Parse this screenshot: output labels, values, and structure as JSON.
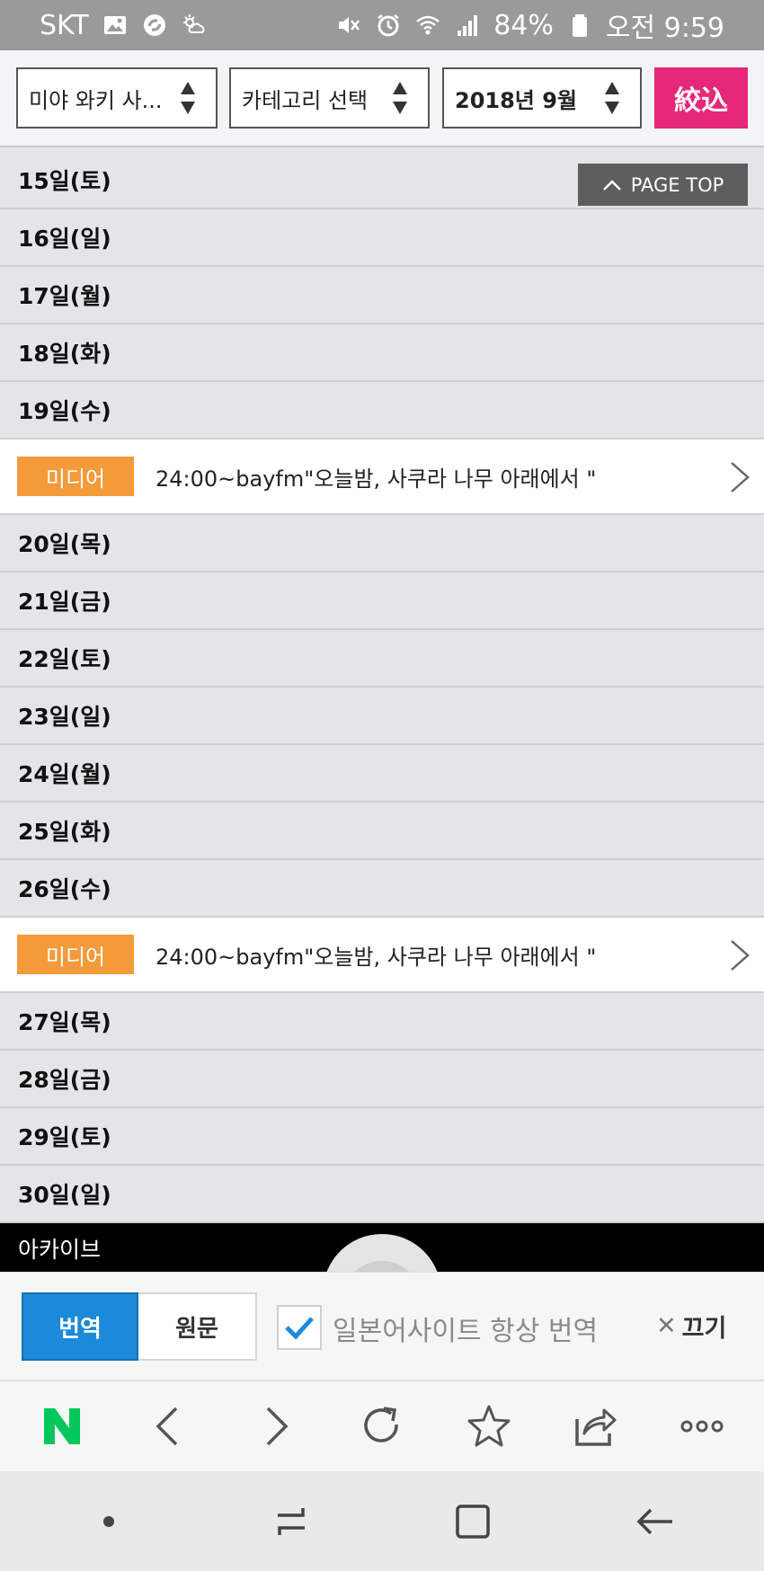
{
  "status_bar": {
    "carrier": "SKT",
    "battery": "84%",
    "time": "오전 9:59",
    "icons": [
      "image-icon",
      "sync-icon",
      "weather-icon",
      "mute-icon",
      "alarm-icon",
      "wifi-icon",
      "signal-icon",
      "battery-icon"
    ]
  },
  "filters": {
    "artist_select": "미야 와키 사...",
    "category_select": "카테고리 선택",
    "month_select": "2018년 9월",
    "filter_button": "絞込"
  },
  "page_top_label": "PAGE TOP",
  "rows": [
    {
      "type": "day",
      "label": "15일(토)"
    },
    {
      "type": "day",
      "label": "16일(일)"
    },
    {
      "type": "day",
      "label": "17일(월)"
    },
    {
      "type": "day",
      "label": "18일(화)"
    },
    {
      "type": "day",
      "label": "19일(수)"
    },
    {
      "type": "event",
      "badge": "미디어",
      "text": "24:00~bayfm\"오늘밤, 사쿠라 나무 아래에서 \""
    },
    {
      "type": "day",
      "label": "20일(목)"
    },
    {
      "type": "day",
      "label": "21일(금)"
    },
    {
      "type": "day",
      "label": "22일(토)"
    },
    {
      "type": "day",
      "label": "23일(일)"
    },
    {
      "type": "day",
      "label": "24일(월)"
    },
    {
      "type": "day",
      "label": "25일(화)"
    },
    {
      "type": "day",
      "label": "26일(수)"
    },
    {
      "type": "event",
      "badge": "미디어",
      "text": "24:00~bayfm\"오늘밤, 사쿠라 나무 아래에서 \""
    },
    {
      "type": "day",
      "label": "27일(목)"
    },
    {
      "type": "day",
      "label": "28일(금)"
    },
    {
      "type": "day",
      "label": "29일(토)"
    },
    {
      "type": "day",
      "label": "30일(일)"
    }
  ],
  "archive_label": "아카이브",
  "translate_bar": {
    "translate_label": "번역",
    "original_label": "원문",
    "always_translate_label": "일본어사이트 항상 번역",
    "always_checked": true,
    "close_label": "끄기"
  },
  "toolbar": {
    "icons": [
      "naver-n-icon",
      "back-icon",
      "forward-icon",
      "reload-icon",
      "bookmark-star-icon",
      "share-icon",
      "more-icon"
    ]
  },
  "colors": {
    "filter_button": "#e6287a",
    "badge": "#f39a3a",
    "translate_active": "#1a8ad9",
    "naver_green": "#03c75a"
  }
}
